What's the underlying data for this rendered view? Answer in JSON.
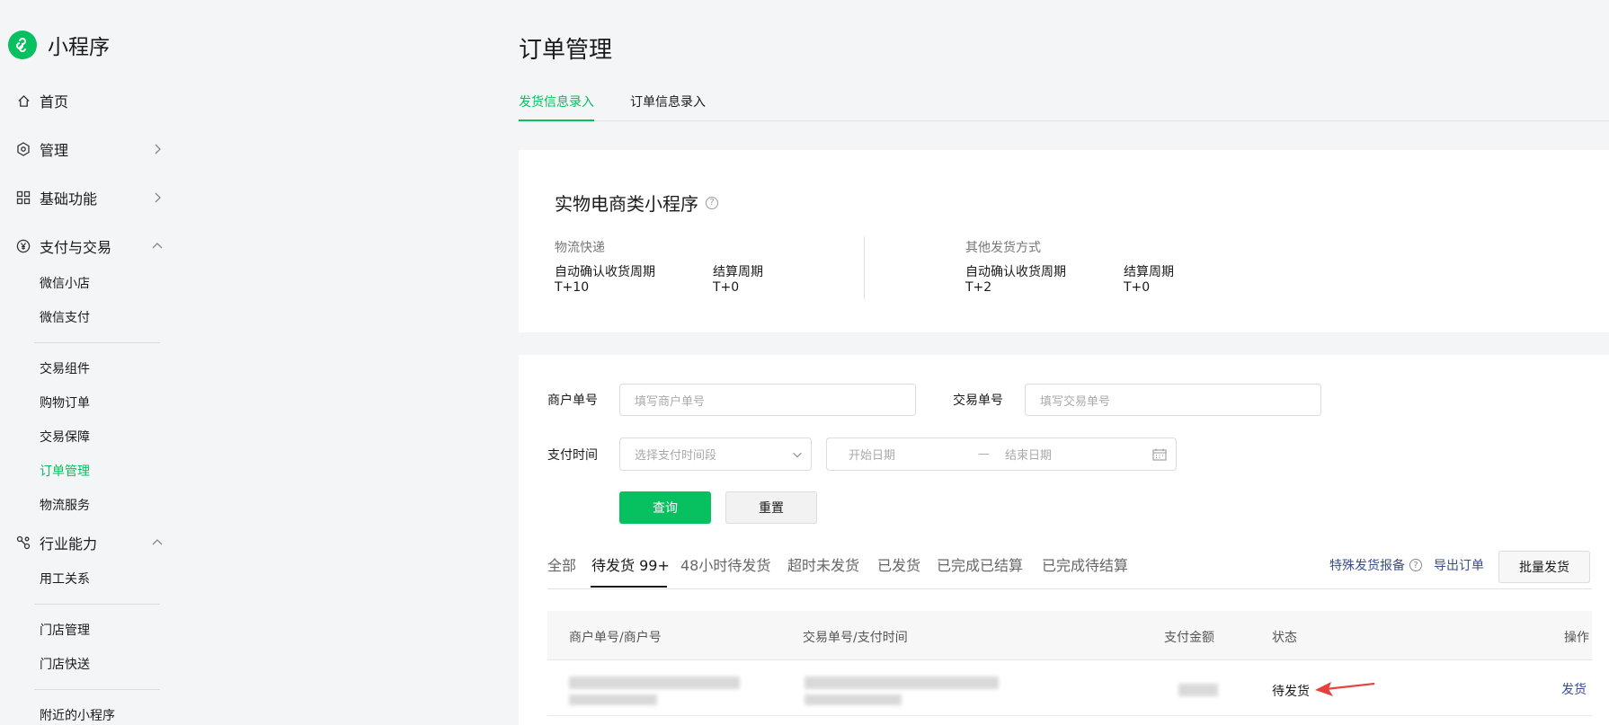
{
  "brand": {
    "name": "小程序",
    "logo_icon": "mini-program-logo-icon",
    "color": "#07c160"
  },
  "sidebar": {
    "nav": {
      "home": {
        "label": "首页",
        "icon": "home-icon"
      },
      "manage": {
        "label": "管理",
        "icon": "hexagon-settings-icon"
      },
      "basic": {
        "label": "基础功能",
        "icon": "grid-icon"
      },
      "payment": {
        "label": "支付与交易",
        "icon": "yen-icon"
      },
      "industry": {
        "label": "行业能力",
        "icon": "link-icon"
      }
    },
    "payment_items": [
      "微信小店",
      "微信支付",
      "交易组件",
      "购物订单",
      "交易保障",
      "订单管理",
      "物流服务"
    ],
    "industry_items": [
      "用工关系",
      "门店管理",
      "门店快送",
      "附近的小程序"
    ],
    "active_item": "订单管理"
  },
  "page": {
    "title": "订单管理",
    "tabs": [
      "发货信息录入",
      "订单信息录入"
    ],
    "active_tab": "发货信息录入"
  },
  "summary": {
    "title": "实物电商类小程序",
    "logistics": {
      "label": "物流快递",
      "confirm_key": "自动确认收货周期",
      "confirm_val": "T+10",
      "settle_key": "结算周期",
      "settle_val": "T+0"
    },
    "other": {
      "label": "其他发货方式",
      "confirm_key": "自动确认收货周期",
      "confirm_val": "T+2",
      "settle_key": "结算周期",
      "settle_val": "T+0"
    }
  },
  "filters": {
    "merchant_label": "商户单号",
    "merchant_placeholder": "填写商户单号",
    "trade_label": "交易单号",
    "trade_placeholder": "填写交易单号",
    "time_label": "支付时间",
    "time_select_placeholder": "选择支付时间段",
    "start_placeholder": "开始日期",
    "range_sep": "—",
    "end_placeholder": "结束日期",
    "query_button": "查询",
    "reset_button": "重置"
  },
  "status_tabs": [
    "全部",
    "待发货 99+",
    "48小时待发货",
    "超时未发货",
    "已发货",
    "已完成已结算",
    "已完成待结算"
  ],
  "active_status_tab": "待发货 99+",
  "actions": {
    "special_report": "特殊发货报备",
    "export": "导出订单",
    "batch_ship": "批量发货"
  },
  "table": {
    "headers": [
      "商户单号/商户号",
      "交易单号/支付时间",
      "支付金额",
      "状态",
      "操作"
    ],
    "rows": [
      {
        "status": "待发货",
        "action": "发货"
      }
    ]
  },
  "annotation": {
    "arrow_color": "#e8403c"
  }
}
